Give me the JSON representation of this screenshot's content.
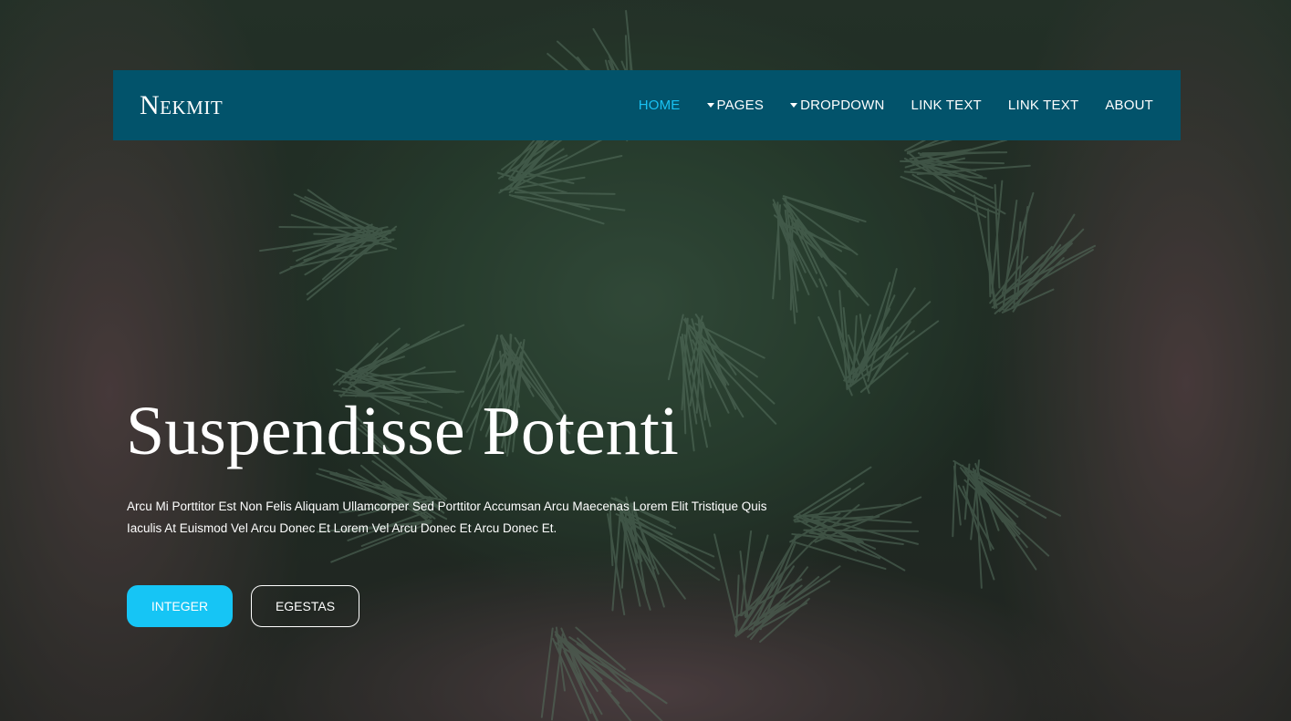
{
  "brand": {
    "name": "Nekmit"
  },
  "nav": {
    "items": [
      {
        "label": "HOME",
        "active": true,
        "dropdown": false
      },
      {
        "label": "PAGES",
        "active": false,
        "dropdown": true
      },
      {
        "label": "DROPDOWN",
        "active": false,
        "dropdown": true
      },
      {
        "label": "LINK TEXT",
        "active": false,
        "dropdown": false
      },
      {
        "label": "LINK TEXT",
        "active": false,
        "dropdown": false
      },
      {
        "label": "ABOUT",
        "active": false,
        "dropdown": false
      }
    ]
  },
  "hero": {
    "title": "Suspendisse Potenti",
    "text": "Arcu Mi Porttitor Est Non Felis Aliquam Ullamcorper Sed Porttitor Accumsan Arcu Maecenas Lorem Elit Tristique Quis Iaculis At Euismod Vel Arcu Donec Et Lorem Vel Arcu Donec Et Arcu Donec Et.",
    "primary_button": "INTEGER",
    "secondary_button": "EGESTAS",
    "image": "hands-holding-pine-needles"
  },
  "colors": {
    "navbar": "#02536b",
    "accent": "#16c5f5",
    "active_link": "#19c1f2"
  }
}
